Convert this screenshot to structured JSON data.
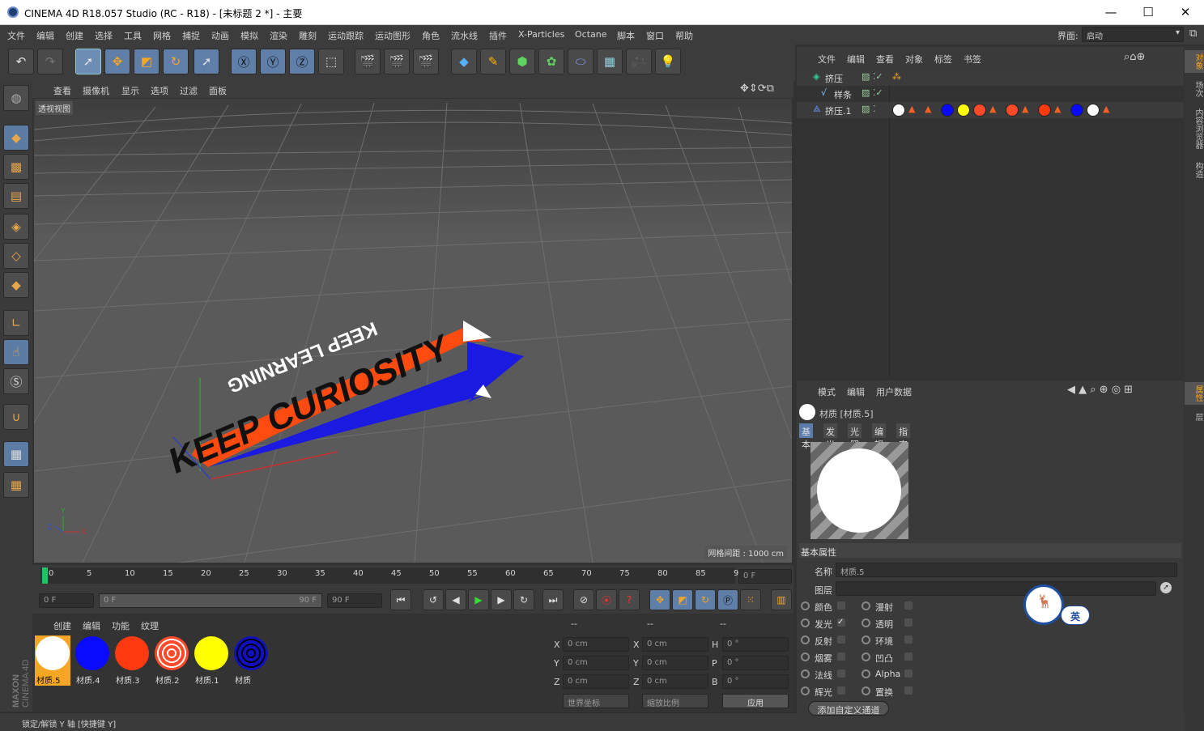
{
  "window": {
    "title": "CINEMA 4D R18.057 Studio (RC - R18) - [未标题 2 *] - 主要",
    "minimize": "—",
    "maximize": "☐",
    "close": "✕"
  },
  "menu": [
    "文件",
    "编辑",
    "创建",
    "选择",
    "工具",
    "网格",
    "捕捉",
    "动画",
    "模拟",
    "渲染",
    "雕刻",
    "运动跟踪",
    "运动图形",
    "角色",
    "流水线",
    "插件",
    "X-Particles",
    "Octane",
    "脚本",
    "窗口",
    "帮助"
  ],
  "layout": {
    "label": "界面:",
    "value": "启动"
  },
  "viewport": {
    "menu": [
      "查看",
      "摄像机",
      "显示",
      "选项",
      "过滤",
      "面板"
    ],
    "label": "透视视图",
    "grid_info": "网格间距 : 1000 cm",
    "text_front": "KEEP CURIOSITY",
    "text_top": "KEEP LEARNING"
  },
  "timeline": {
    "ticks": [
      "0",
      "5",
      "10",
      "15",
      "20",
      "25",
      "30",
      "35",
      "40",
      "45",
      "50",
      "55",
      "60",
      "65",
      "70",
      "75",
      "80",
      "85",
      "90"
    ],
    "current": "0 F",
    "start": "0 F",
    "range_start": "0 F",
    "range_end": "90 F",
    "end": "90 F"
  },
  "materials": {
    "menu": [
      "创建",
      "编辑",
      "功能",
      "纹理"
    ],
    "items": [
      {
        "name": "材质.5",
        "color": "#ffffff",
        "selected": true
      },
      {
        "name": "材质.4",
        "color": "#0a0aff"
      },
      {
        "name": "材质.3",
        "color": "#ff3a10"
      },
      {
        "name": "材质.2",
        "color": "#ff4a2a"
      },
      {
        "name": "材质.1",
        "color": "#ffff00"
      },
      {
        "name": "材质",
        "color": "#1010c0"
      }
    ]
  },
  "coords": {
    "header": [
      "--",
      "--",
      "--"
    ],
    "rows": [
      {
        "a": "X",
        "av": "0 cm",
        "b": "X",
        "bv": "0 cm",
        "c": "H",
        "cv": "0 °"
      },
      {
        "a": "Y",
        "av": "0 cm",
        "b": "Y",
        "bv": "0 cm",
        "c": "P",
        "cv": "0 °"
      },
      {
        "a": "Z",
        "av": "0 cm",
        "b": "Z",
        "bv": "0 cm",
        "c": "B",
        "cv": "0 °"
      }
    ],
    "world": "世界坐标",
    "scale": "缩放比例",
    "apply": "应用"
  },
  "status": "锁定/解锁 Y 轴 [快捷键 Y]",
  "brand": {
    "line1": "MAXON",
    "line2": "CINEMA 4D"
  },
  "objects": {
    "menu": [
      "文件",
      "编辑",
      "查看",
      "对象",
      "标签",
      "书签"
    ],
    "items": [
      {
        "name": "挤压",
        "indent": 0
      },
      {
        "name": "样条",
        "indent": 1
      },
      {
        "name": "挤压.1",
        "indent": 0
      }
    ]
  },
  "attributes": {
    "menu": [
      "模式",
      "编辑",
      "用户数据"
    ],
    "title": "材质 [材质.5]",
    "tabs": [
      "基本",
      "发光",
      "光照",
      "编辑",
      "指定"
    ],
    "section": "基本属性",
    "name_label": "名称",
    "name_value": "材质.5",
    "layer_label": "图层",
    "channels_left": [
      "颜色",
      "发光",
      "反射",
      "烟雾",
      "法线",
      "辉光"
    ],
    "channels_right": [
      "漫射",
      "透明",
      "环境",
      "凹凸",
      "Alpha",
      "置换"
    ],
    "add_button": "添加自定义通道",
    "ime": "英"
  },
  "right_tabs": [
    "对象",
    "场次",
    "内容浏览器",
    "构造",
    "属性",
    "层"
  ]
}
